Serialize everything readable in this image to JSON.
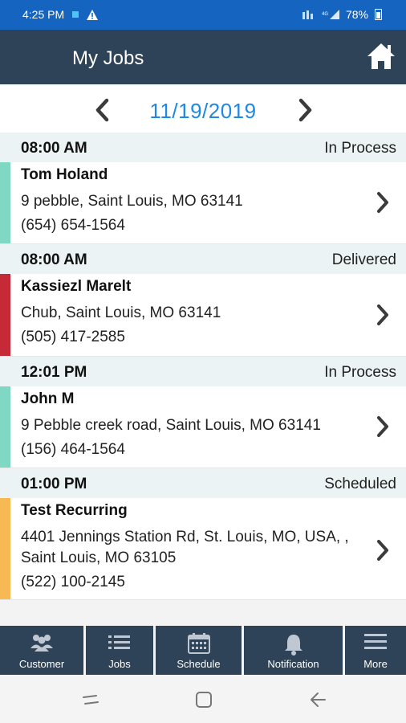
{
  "status_bar": {
    "time": "4:25 PM",
    "battery": "78%"
  },
  "app_bar": {
    "title": "My Jobs"
  },
  "date_nav": {
    "date": "11/19/2019"
  },
  "colors": {
    "in_process": "#7fd8c4",
    "delivered": "#c62a37",
    "scheduled": "#f7b954",
    "app_bar": "#2e4258",
    "date": "#1e88e5"
  },
  "jobs": [
    {
      "time": "08:00 AM",
      "status": "In Process",
      "name": "Tom Holand",
      "address": "9 pebble, Saint Louis, MO 63141",
      "phone": "(654) 654-1564"
    },
    {
      "time": "08:00 AM",
      "status": "Delivered",
      "name": "Kassiezl Marelt",
      "address": "Chub, Saint Louis, MO 63141",
      "phone": "(505) 417-2585"
    },
    {
      "time": "12:01 PM",
      "status": "In Process",
      "name": "John M",
      "address": "9 Pebble creek road, Saint Louis, MO 63141",
      "phone": "(156) 464-1564"
    },
    {
      "time": "01:00 PM",
      "status": "Scheduled",
      "name": "Test Recurring",
      "address": "4401 Jennings Station Rd, St. Louis, MO, USA, , Saint Louis, MO 63105",
      "phone": "(522) 100-2145"
    }
  ],
  "bottom_nav": [
    {
      "label": "Customer",
      "icon": "people-icon"
    },
    {
      "label": "Jobs",
      "icon": "list-icon"
    },
    {
      "label": "Schedule",
      "icon": "calendar-icon"
    },
    {
      "label": "Notification",
      "icon": "bell-icon"
    },
    {
      "label": "More",
      "icon": "menu-icon"
    }
  ]
}
